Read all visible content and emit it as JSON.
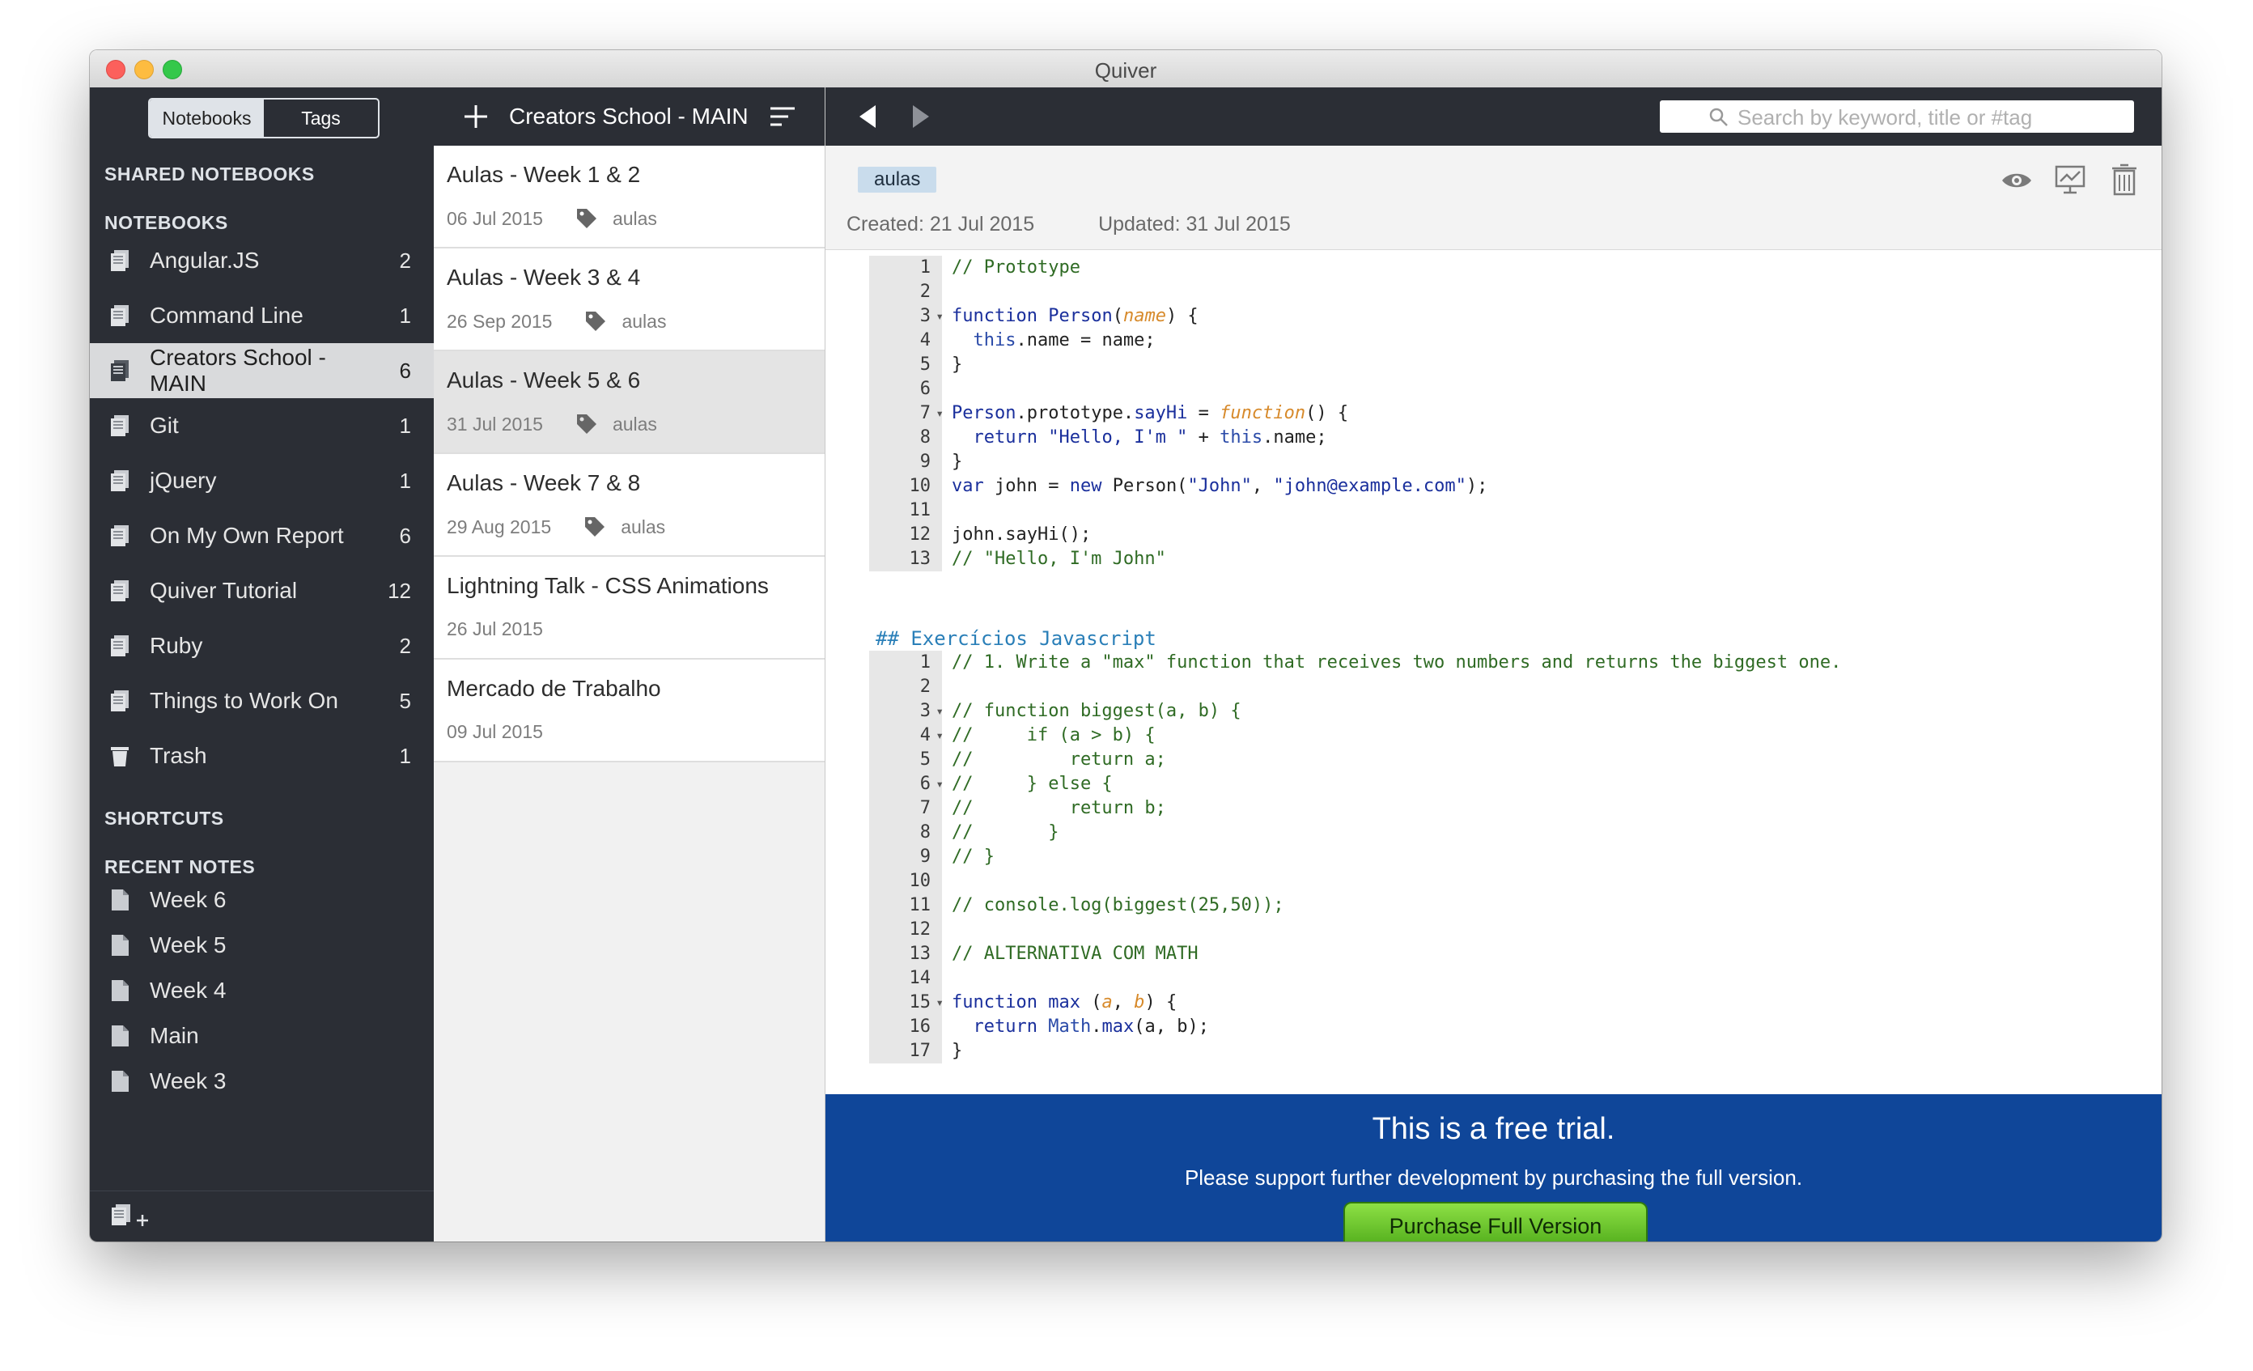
{
  "window": {
    "title": "Quiver"
  },
  "sidebar": {
    "segments": [
      "Notebooks",
      "Tags"
    ],
    "sections": {
      "shared": "SHARED NOTEBOOKS",
      "notebooks": "NOTEBOOKS",
      "shortcuts": "SHORTCUTS",
      "recent": "RECENT NOTES"
    },
    "notebooks": [
      {
        "label": "Angular.JS",
        "count": "2"
      },
      {
        "label": "Command Line",
        "count": "1"
      },
      {
        "label": "Creators School - MAIN",
        "count": "6"
      },
      {
        "label": "Git",
        "count": "1"
      },
      {
        "label": "jQuery",
        "count": "1"
      },
      {
        "label": "On My Own Report",
        "count": "6"
      },
      {
        "label": "Quiver Tutorial",
        "count": "12"
      },
      {
        "label": "Ruby",
        "count": "2"
      },
      {
        "label": "Things to Work On",
        "count": "5"
      },
      {
        "label": "Trash",
        "count": "1"
      }
    ],
    "recent_notes": [
      "Week 6",
      "Week 5",
      "Week 4",
      "Main",
      "Week 3"
    ]
  },
  "notes_list": {
    "title": "Creators School - MAIN",
    "notes": [
      {
        "title": "Aulas - Week 1 & 2",
        "date": "06 Jul 2015",
        "tag": "aulas"
      },
      {
        "title": "Aulas - Week 3 & 4",
        "date": "26 Sep 2015",
        "tag": "aulas"
      },
      {
        "title": "Aulas - Week 5 & 6",
        "date": "31 Jul 2015",
        "tag": "aulas"
      },
      {
        "title": "Aulas - Week 7 & 8",
        "date": "29 Aug 2015",
        "tag": "aulas"
      },
      {
        "title": "Lightning Talk - CSS Animations",
        "date": "26 Jul 2015",
        "tag": ""
      },
      {
        "title": "Mercado de Trabalho",
        "date": "09 Jul 2015",
        "tag": ""
      }
    ]
  },
  "editor": {
    "search_placeholder": "Search by keyword, title or #tag",
    "tag": "aulas",
    "created": "Created: 21 Jul 2015",
    "updated": "Updated: 31 Jul 2015",
    "markdown_heading": "## Exercícios Javascript",
    "line_numbers_1": [
      "1",
      "2",
      "3",
      "4",
      "5",
      "6",
      "7",
      "8",
      "9",
      "10",
      "11",
      "12",
      "13"
    ],
    "line_numbers_2": [
      "1",
      "2",
      "3",
      "4",
      "5",
      "6",
      "7",
      "8",
      "9",
      "10",
      "11",
      "12",
      "13",
      "14",
      "15",
      "16",
      "17"
    ]
  },
  "trial": {
    "title": "This is a free trial.",
    "subtitle": "Please support further development by purchasing the full version.",
    "button": "Purchase Full Version"
  },
  "colors": {
    "sidebar_bg": "#2b2e35",
    "trial_bg": "#0f4699",
    "button_green": "#6cc22f",
    "tag_pill": "#c9dcec"
  }
}
